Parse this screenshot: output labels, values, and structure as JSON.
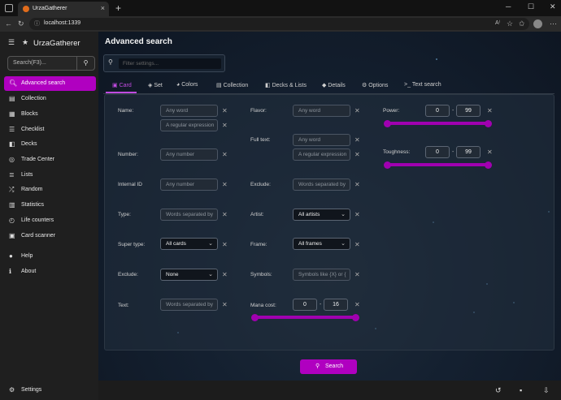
{
  "browser": {
    "tab_title": "UrzaGatherer",
    "url": "localhost:1339",
    "newtab": "+",
    "minimize": "─",
    "maximize": "☐",
    "close": "✕"
  },
  "app": {
    "title": "UrzaGatherer"
  },
  "sidebar": {
    "search_placeholder": "Search(F3)...",
    "items": [
      {
        "label": "Advanced search",
        "icon": "🔍︎"
      },
      {
        "label": "Collection",
        "icon": "▤"
      },
      {
        "label": "Blocks",
        "icon": "▦"
      },
      {
        "label": "Checklist",
        "icon": "☰"
      },
      {
        "label": "Decks",
        "icon": "◧"
      },
      {
        "label": "Trade Center",
        "icon": "◎"
      },
      {
        "label": "Lists",
        "icon": "≣"
      },
      {
        "label": "Random",
        "icon": "⤮"
      },
      {
        "label": "Statistics",
        "icon": "▥"
      },
      {
        "label": "Life counters",
        "icon": "◴"
      },
      {
        "label": "Card scanner",
        "icon": "▣"
      },
      {
        "label": "Help",
        "icon": "●"
      },
      {
        "label": "About",
        "icon": "ℹ"
      }
    ],
    "settings": "Settings"
  },
  "main": {
    "title": "Advanced search",
    "filter_placeholder": "Filter settings...",
    "tabs": [
      {
        "label": "Card"
      },
      {
        "label": "Set"
      },
      {
        "label": "Colors"
      },
      {
        "label": "Collection"
      },
      {
        "label": "Decks & Lists"
      },
      {
        "label": "Details"
      },
      {
        "label": "Options"
      },
      {
        "label": "Text search"
      }
    ],
    "fields": {
      "name_label": "Name:",
      "name_ph1": "Any word",
      "name_ph2": "A regular expression",
      "number_label": "Number:",
      "number_ph": "Any number",
      "internal_id_label": "Internal ID",
      "internal_id_ph": "Any number",
      "type_label": "Type:",
      "type_ph": "Words separated by commas",
      "super_type_label": "Super type:",
      "super_type_value": "All cards",
      "exclude1_label": "Exclude:",
      "exclude1_value": "None",
      "text_label": "Text:",
      "text_ph": "Words separated by commas",
      "flavor_label": "Flavor:",
      "flavor_ph": "Any word",
      "fulltext_label": "Full text:",
      "fulltext_ph1": "Any word",
      "fulltext_ph2": "A regular expression",
      "exclude2_label": "Exclude:",
      "exclude2_ph": "Words separated by commas",
      "artist_label": "Artist:",
      "artist_value": "All artists",
      "frame_label": "Frame:",
      "frame_value": "All frames",
      "symbols_label": "Symbols:",
      "symbols_ph": "Symbols like {X} or {R}",
      "mana_label": "Mana cost:",
      "mana_min": "0",
      "mana_max": "16",
      "power_label": "Power:",
      "power_min": "0",
      "power_max": "99",
      "tough_label": "Toughness:",
      "tough_min": "0",
      "tough_max": "99",
      "dash": "-",
      "clear": "✕"
    },
    "search_button": "Search"
  },
  "colors": {
    "accent": "#b000c0"
  }
}
